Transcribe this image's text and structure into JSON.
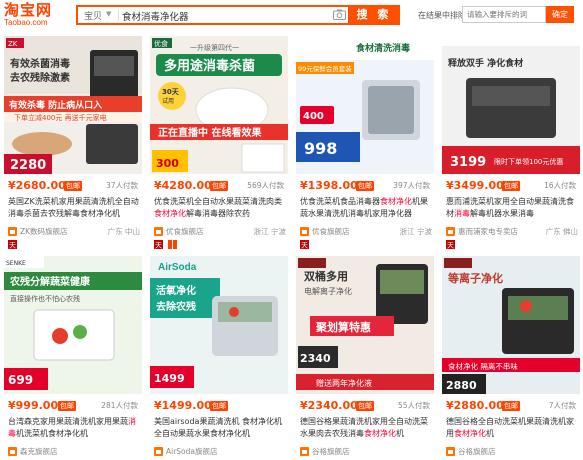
{
  "header": {
    "logo_main": "淘宝网",
    "logo_sub": "Taobao.com",
    "search_type": "宝贝",
    "search_query": "食材消毒净化器",
    "search_button": "搜 索",
    "exclude_label": "在结果中排除",
    "exclude_placeholder": "请输入要排斥的词",
    "exclude_button": "确定"
  },
  "products": [
    {
      "image_text": [
        "有效杀菌消毒",
        "去农残除激素",
        "有效杀毒 防止病从口入",
        "下单立减400元 再送千元家电",
        "2280"
      ],
      "price": "¥2680.00",
      "badge": "包邮",
      "sales": "37人付款",
      "title_pre": "英国ZK洗菜机家用果蔬清洗机全自动",
      "title_hl": "",
      "title_post": "消毒杀菌去农残解毒食材净化机",
      "shop": "ZK数码旗舰店",
      "location": "广东 中山"
    },
    {
      "image_text": [
        "一升级第四代一",
        "多用途消毒杀菌",
        "30天试用",
        "正在直播中 在线看效果",
        "300"
      ],
      "price": "¥4280.00",
      "badge": "包邮",
      "sales": "569人付款",
      "title_pre": "优食洗菜机全自动水果蔬菜清洗肉类",
      "title_hl": "食材净化",
      "title_post": "解毒消毒器除农药",
      "shop": "优食旗舰店",
      "location": "浙江 宁波"
    },
    {
      "image_text": [
        "食材清洗消毒",
        "99元保鲜会员套装",
        "400",
        "998"
      ],
      "price": "¥1398.00",
      "badge": "包邮",
      "sales": "397人付款",
      "title_pre": "优食洗菜机食品消毒器",
      "title_hl": "食材净化",
      "title_post": "机果蔬水果清洗机消毒机家用净化器",
      "shop": "优食旗舰店",
      "location": "浙江 宁波"
    },
    {
      "image_text": [
        "释放双手 净化食材",
        "3199",
        "限时下单领100元优惠"
      ],
      "price": "¥3499.00",
      "badge": "包邮",
      "sales": "16人付款",
      "title_pre": "惠而浦洗菜机家用全自动果蔬清洗食材",
      "title_hl": "消毒",
      "title_post": "解毒机器水果消毒",
      "shop": "惠而浦家电专卖店",
      "location": "广东 佛山"
    },
    {
      "image_text": [
        "农残分解蔬菜健康",
        "直接操作也不怕心农残",
        "699"
      ],
      "price": "¥999.00",
      "badge": "包邮",
      "sales": "281人付款",
      "title_pre": "台湾森克家用果蔬清洗机家用果蔬",
      "title_hl": "消毒",
      "title_post": "机洗菜机食材净化机",
      "shop": "森克旗舰店",
      "location": ""
    },
    {
      "image_text": [
        "AirSoda",
        "活氧净化",
        "去除农残",
        "1499"
      ],
      "price": "¥1499.00",
      "badge": "包邮",
      "sales": "",
      "title_pre": "美国airsoda果蔬清洗机 食材净化机全自动果蔬水果食材净化机",
      "title_hl": "",
      "title_post": "",
      "shop": "AirSoda旗舰店",
      "location": ""
    },
    {
      "image_text": [
        "双桶多用",
        "电解离子净化",
        "聚划算特惠",
        "2340",
        "赠送两年净化液"
      ],
      "price": "¥2340.00",
      "badge": "包邮",
      "sales": "55人付款",
      "title_pre": "德国谷格果蔬清洗机家用全自动洗菜水果肉去农残消毒",
      "title_hl": "食材净化",
      "title_post": "机",
      "shop": "谷格旗舰店",
      "location": ""
    },
    {
      "image_text": [
        "等离子净化",
        "食材净化 隔离不串味",
        "2880"
      ],
      "price": "¥2880.00",
      "badge": "包邮",
      "sales": "7人付款",
      "title_pre": "德国谷格全自动洗菜机果蔬清洗机家用",
      "title_hl": "食材净化",
      "title_post": "机",
      "shop": "谷格旗舰店",
      "location": ""
    }
  ],
  "colors": {
    "accent": "#ff5000",
    "price": "#ff4400",
    "highlight": "#ff0036"
  }
}
